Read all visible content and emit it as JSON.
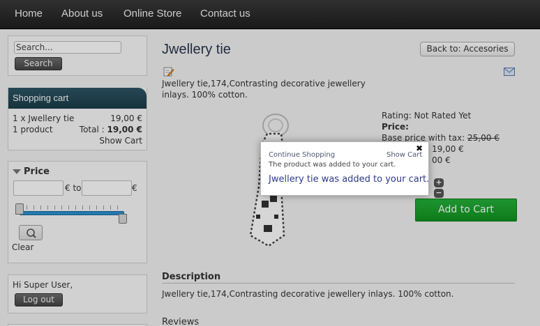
{
  "nav": {
    "items": [
      "Home",
      "About us",
      "Online Store",
      "Contact us"
    ]
  },
  "search": {
    "value": "Search...",
    "button": "Search"
  },
  "cart": {
    "title": "Shopping cart",
    "line_item": "1 x Jwellery tie",
    "line_price": "19,00 €",
    "count": "1 product",
    "total_label": "Total :",
    "total_value": "19,00 €",
    "show_cart": "Show Cart"
  },
  "price_filter": {
    "title": "Price",
    "from_unit": "€ to",
    "to_unit": "€",
    "clear": "Clear"
  },
  "user": {
    "greeting": "Hi Super User,",
    "logout": "Log out"
  },
  "product": {
    "title": "Jwellery tie",
    "back": "Back to: Accesories",
    "short_desc": "Jwellery tie,174,Contrasting decorative jewellery inlays. 100% cotton.",
    "rating": "Rating: Not Rated Yet",
    "price_label": "Price:",
    "base_price_label": "Base price with tax:",
    "base_price_old": "25,00 €",
    "sales_price": "19,00 €",
    "discount_tail": "00 €",
    "add_to_cart": "Add to Cart",
    "qty_plus": "+",
    "qty_minus": "−"
  },
  "description": {
    "heading": "Description",
    "text": "Jwellery tie,174,Contrasting decorative jewellery inlays. 100% cotton."
  },
  "reviews": {
    "heading": "Reviews"
  },
  "popup": {
    "continue": "Continue Shopping",
    "show_cart": "Show Cart",
    "added_small": "The product was added to your cart.",
    "added_big": "Jwellery tie was added to your cart.",
    "close": "✖"
  },
  "colors": {
    "nav_bg": "#2b2b2b",
    "cart_header": "#234a58",
    "add_to_cart": "#1aa12d",
    "slider": "#2a8fd1"
  }
}
